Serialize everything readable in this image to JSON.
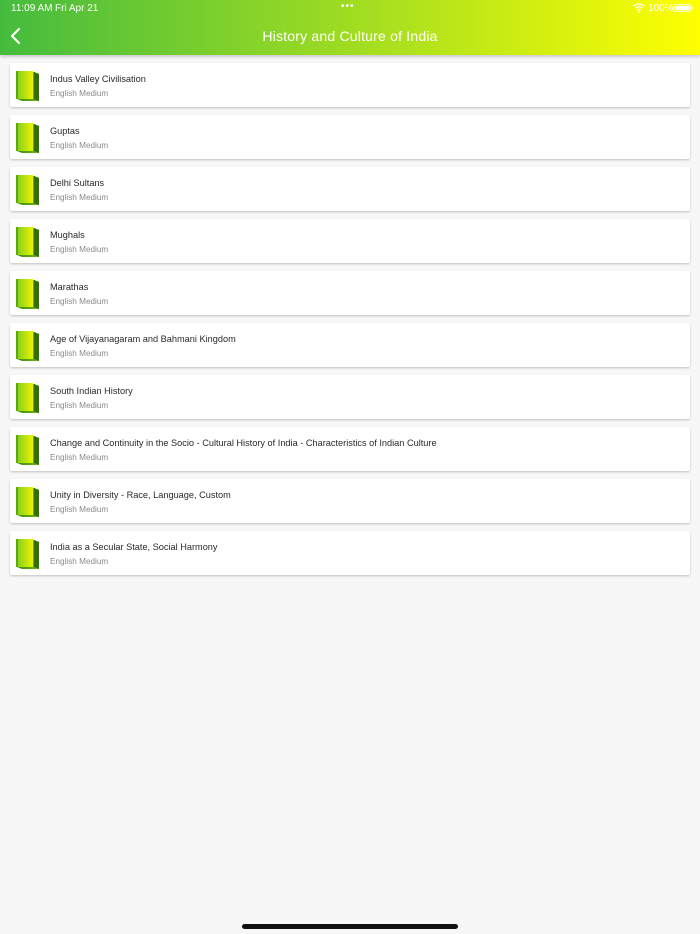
{
  "status_bar": {
    "time": "11:09 AM",
    "date": "Fri Apr 21",
    "dots": "•••",
    "battery": "100%"
  },
  "header": {
    "title": "History and Culture of India",
    "gradient_start": "#45bb3e",
    "gradient_end": "#ffff00"
  },
  "items": [
    {
      "title": "Indus Valley Civilisation",
      "subtitle": "English Medium"
    },
    {
      "title": "Guptas",
      "subtitle": "English Medium"
    },
    {
      "title": "Delhi Sultans",
      "subtitle": "English Medium"
    },
    {
      "title": "Mughals",
      "subtitle": "English Medium"
    },
    {
      "title": "Marathas",
      "subtitle": "English Medium"
    },
    {
      "title": "Age of Vijayanagaram and Bahmani Kingdom",
      "subtitle": "English Medium"
    },
    {
      "title": "South Indian History",
      "subtitle": "English Medium"
    },
    {
      "title": "Change and Continuity in the Socio - Cultural History of India - Characteristics of Indian Culture",
      "subtitle": "English Medium"
    },
    {
      "title": "Unity in Diversity - Race, Language, Custom",
      "subtitle": "English Medium"
    },
    {
      "title": "India as a Secular State, Social Harmony",
      "subtitle": "English Medium"
    }
  ],
  "icons": {
    "item_icon": "book-icon",
    "back": "back-chevron-icon"
  }
}
